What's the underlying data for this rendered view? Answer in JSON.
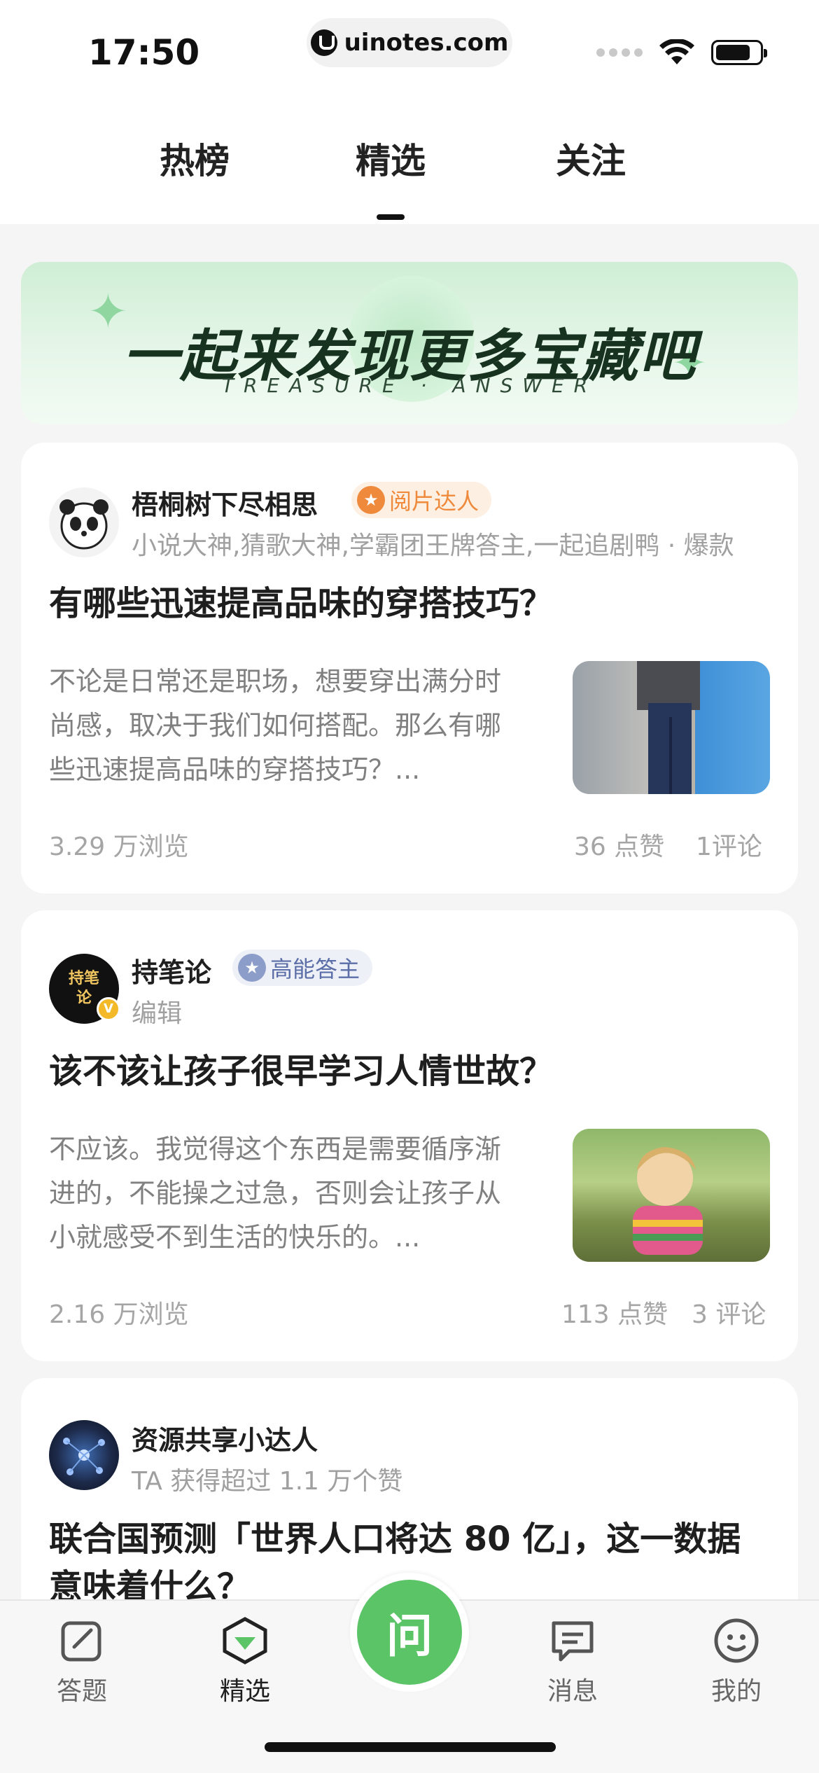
{
  "status_bar": {
    "time": "17:50",
    "url": "uinotes.com"
  },
  "tabs": [
    {
      "label": "热榜",
      "active": false
    },
    {
      "label": "精选",
      "active": true
    },
    {
      "label": "关注",
      "active": false
    }
  ],
  "banner": {
    "title": "一起来发现更多宝藏吧",
    "subtitle": "TREASURE · ANSWER"
  },
  "feed": [
    {
      "author": "梧桐树下尽相思",
      "badge": "阅片达人",
      "author_desc": "小说大神,猜歌大神,学霸团王牌答主,一起追剧鸭 · 爆款",
      "title": "有哪些迅速提高品味的穿搭技巧？",
      "excerpt": "不论是日常还是职场，想要穿出满分时尚感，取决于我们如何搭配。那么有哪些迅速提高品味的穿搭技巧？...",
      "views": "3.29 万浏览",
      "likes": "36 点赞",
      "comments": "1评论"
    },
    {
      "author": "持笔论",
      "avatar_text": "持笔论",
      "badge": "高能答主",
      "author_desc": "编辑",
      "title": "该不该让孩子很早学习人情世故？",
      "excerpt": "不应该。我觉得这个东西是需要循序渐进的，不能操之过急，否则会让孩子从小就感受不到生活的快乐的。...",
      "views": "2.16 万浏览",
      "likes": "113 点赞",
      "comments": "3 评论"
    },
    {
      "author": "资源共享小达人",
      "author_desc": "TA 获得超过 1.1 万个赞",
      "title": "联合国预测「世界人口将达 80 亿」，这一数据意味着什么？"
    }
  ],
  "bottom_nav": {
    "answer": "答题",
    "featured": "精选",
    "ask": "问",
    "messages": "消息",
    "mine": "我的"
  },
  "colors": {
    "accent_green": "#5bc467",
    "badge_orange": "#ef8a3c",
    "badge_blue": "#5b6ea8"
  }
}
